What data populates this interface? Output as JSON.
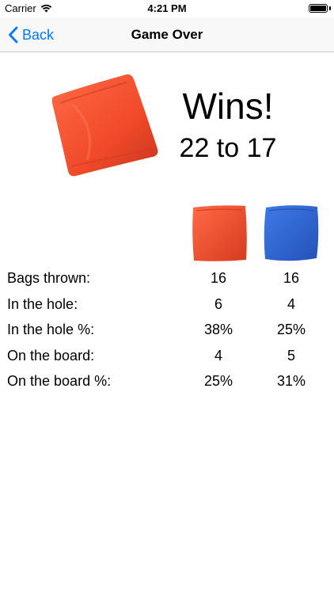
{
  "status_bar": {
    "carrier": "Carrier",
    "time": "4:21 PM",
    "wifi_icon": "wifi-icon",
    "battery_icon": "battery-icon"
  },
  "nav": {
    "back_label": "Back",
    "back_icon": "chevron-left-icon",
    "title": "Game Over"
  },
  "result": {
    "winner_team_color": "#f04a2a",
    "headline": "Wins!",
    "score": "22 to 17"
  },
  "teams": [
    {
      "color": "#f04a2a"
    },
    {
      "color": "#2f67d6"
    }
  ],
  "stats": [
    {
      "label": "Bags thrown:",
      "red": "16",
      "blue": "16"
    },
    {
      "label": "In the hole:",
      "red": "6",
      "blue": "4"
    },
    {
      "label": "In the hole %:",
      "red": "38%",
      "blue": "25%"
    },
    {
      "label": "On the board:",
      "red": "4",
      "blue": "5"
    },
    {
      "label": "On the board %:",
      "red": "25%",
      "blue": "31%"
    }
  ],
  "colors": {
    "accent": "#007aff",
    "red_team": "#f04a2a",
    "blue_team": "#2f67d6"
  }
}
